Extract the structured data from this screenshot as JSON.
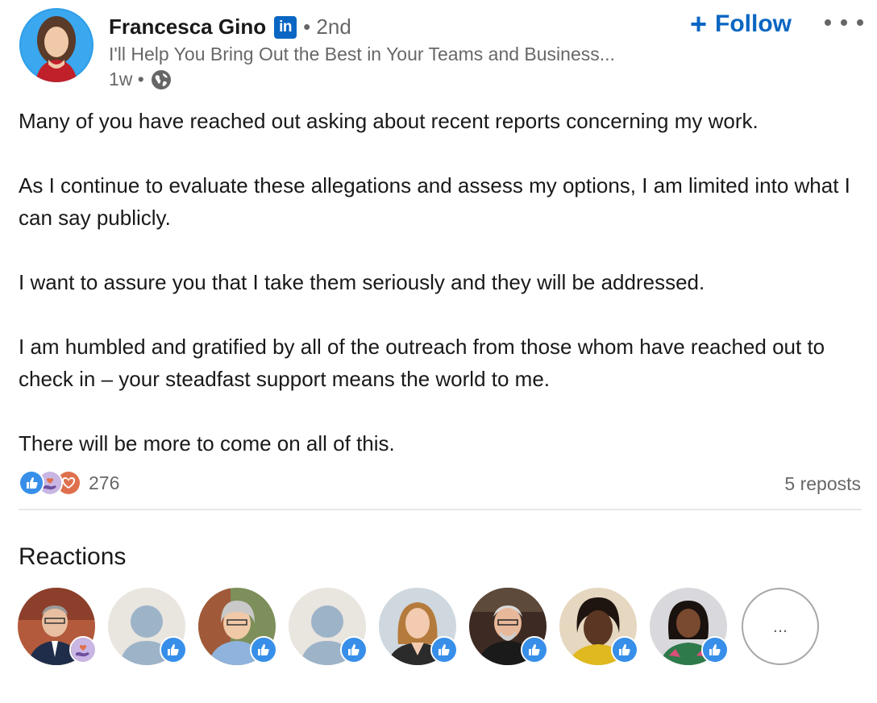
{
  "author": {
    "name": "Francesca Gino",
    "network_badge": "in",
    "degree": "• 2nd",
    "headline": "I'll Help You Bring Out the Best in Your Teams and Business...",
    "time_ago": "1w •",
    "visibility_icon": "globe-icon"
  },
  "actions": {
    "follow_label": "Follow",
    "follow_icon": "+",
    "more_icon": "ellipsis-icon"
  },
  "post": {
    "paragraphs": [
      "Many of you have reached out asking about recent reports concerning my work.",
      "As I continue to evaluate these allegations and assess my options, I am limited into what I can say publicly.",
      "I want to assure you that I take them seriously and they will be addressed.",
      "I am humbled and gratified by all of the outreach from those whom have reached out to check in – your steadfast support means the world to me.",
      "There will be more to come on all of this."
    ]
  },
  "social": {
    "reaction_icons": [
      "like-icon",
      "support-icon",
      "love-icon"
    ],
    "reaction_count": "276",
    "reposts": "5 reposts"
  },
  "reactions": {
    "title": "Reactions",
    "more_label": "...",
    "people": [
      {
        "avatar": "photo-avatar",
        "reaction": "support-icon"
      },
      {
        "avatar": "placeholder-avatar",
        "reaction": "like-icon"
      },
      {
        "avatar": "photo-avatar",
        "reaction": "like-icon"
      },
      {
        "avatar": "placeholder-avatar",
        "reaction": "like-icon"
      },
      {
        "avatar": "photo-avatar",
        "reaction": "like-icon"
      },
      {
        "avatar": "photo-avatar",
        "reaction": "like-icon"
      },
      {
        "avatar": "photo-avatar",
        "reaction": "like-icon"
      },
      {
        "avatar": "photo-avatar",
        "reaction": "like-icon"
      }
    ]
  },
  "colors": {
    "brand_blue": "#0a66c2",
    "like_blue": "#378fe9",
    "love_red": "#df704d",
    "support_purple": "#c9b6e4"
  }
}
